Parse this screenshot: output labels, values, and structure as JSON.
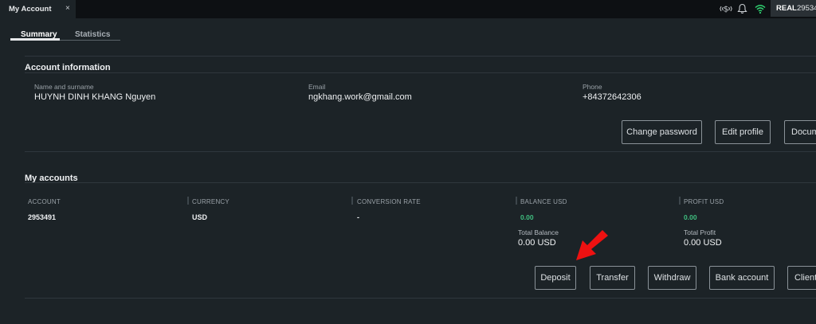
{
  "window": {
    "tab_title": "My Account",
    "close_symbol": "×",
    "account_mode": "REAL",
    "account_number_short": "29534"
  },
  "icons": [
    "dollar-signal-icon",
    "bell-icon",
    "wifi-icon"
  ],
  "colors": {
    "accent_green": "#3fbf7f",
    "wifi_green": "#2fcf6f",
    "arrow_red": "#ee1111"
  },
  "subtabs": [
    {
      "label": "Summary",
      "active": true
    },
    {
      "label": "Statistics",
      "active": false
    }
  ],
  "account_info": {
    "title": "Account information",
    "name_label": "Name and surname",
    "name_value": "HUYNH DINH KHANG Nguyen",
    "email_label": "Email",
    "email_value": "ngkhang.work@gmail.com",
    "phone_label": "Phone",
    "phone_value": "+84372642306",
    "buttons": [
      "Change password",
      "Edit profile",
      "Documents"
    ]
  },
  "my_accounts": {
    "title": "My accounts",
    "columns": [
      "ACCOUNT",
      "CURRENCY",
      "CONVERSION RATE",
      "BALANCE USD",
      "PROFIT USD"
    ],
    "row": {
      "account": "2953491",
      "currency": "USD",
      "conversion_rate": "-",
      "balance": "0.00",
      "profit": "0.00"
    },
    "total_balance_label": "Total Balance",
    "total_balance_value": "0.00 USD",
    "total_profit_label": "Total Profit",
    "total_profit_value": "0.00 USD",
    "buttons": [
      "Deposit",
      "Transfer",
      "Withdraw",
      "Bank account",
      "Client"
    ]
  }
}
